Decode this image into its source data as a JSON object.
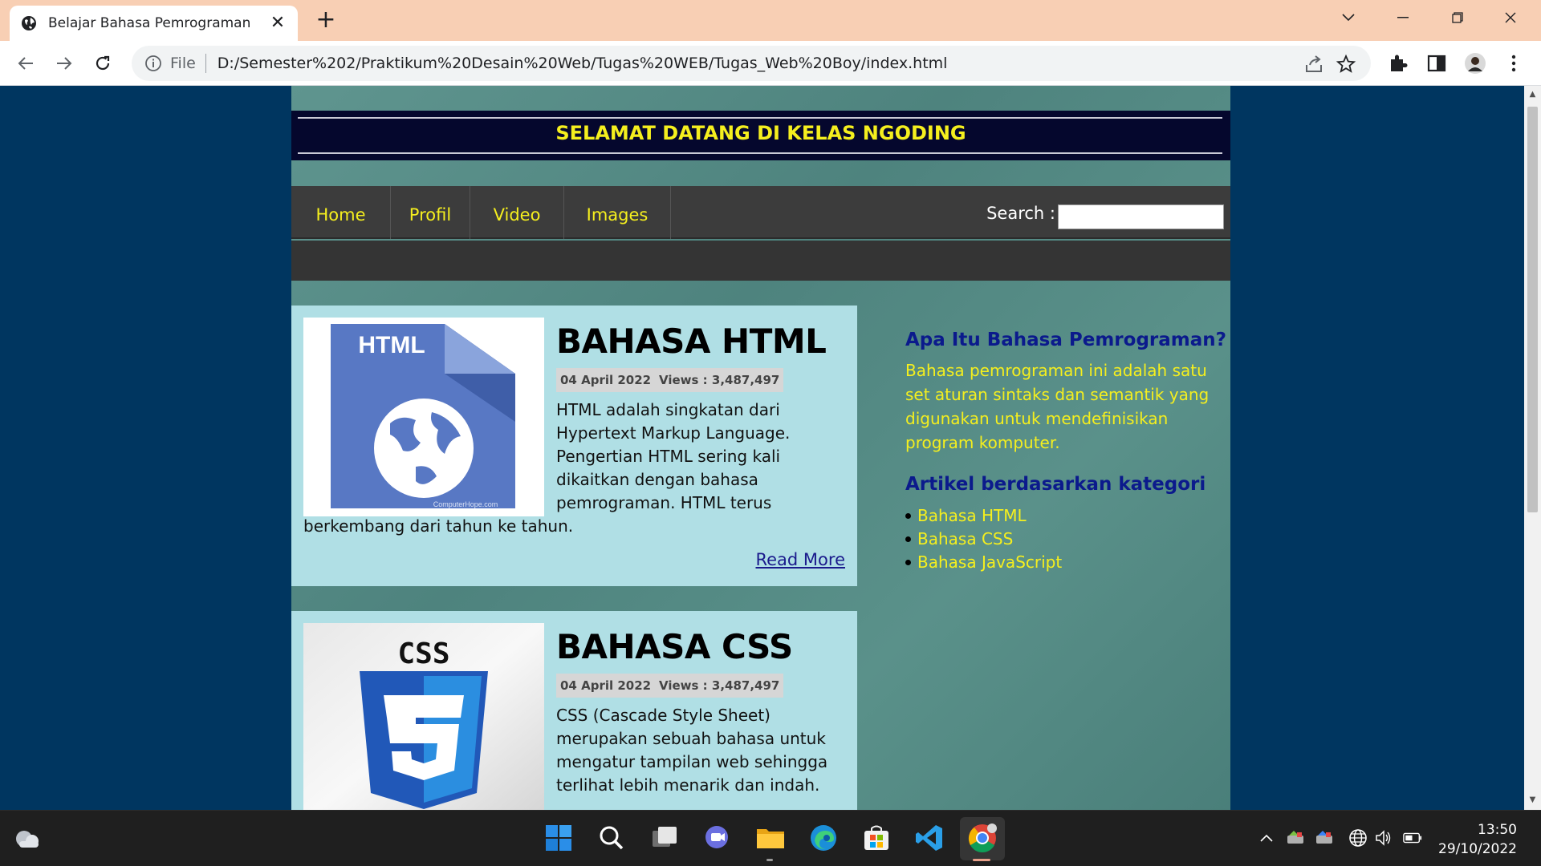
{
  "browser": {
    "tab_title": "Belajar Bahasa Pemrograman",
    "tab_close": "✕",
    "new_tab": "+",
    "scheme": "File",
    "url": "D:/Semester%202/Praktikum%20Desain%20Web/Tugas%20WEB/Tugas_Web%20Boy/index.html"
  },
  "site": {
    "banner_title": "SELAMAT DATANG DI KELAS NGODING",
    "nav": [
      "Home",
      "Profil",
      "Video",
      "Images"
    ],
    "search_label": "Search :",
    "search_value": ""
  },
  "articles": [
    {
      "title": "BAHASA HTML",
      "date": "04 April 2022",
      "views": "Views : 3,487,497",
      "body": "HTML adalah singkatan dari Hypertext Markup Language. Pengertian HTML sering kali dikaitkan dengan bahasa pemrograman. HTML terus",
      "body_tail": "berkembang dari tahun ke tahun.",
      "read_more": "Read More",
      "image_label": "HTML",
      "image_credit": "ComputerHope.com"
    },
    {
      "title": "BAHASA CSS",
      "date": "04 April 2022",
      "views": "Views : 3,487,497",
      "body": "CSS (Cascade Style Sheet) merupakan sebuah bahasa untuk mengatur tampilan web sehingga terlihat lebih menarik dan indah.",
      "image_label": "CSS"
    }
  ],
  "sidebar": {
    "heading1": "Apa Itu Bahasa Pemrograman?",
    "paragraph": "Bahasa pemrograman ini adalah satu set aturan sintaks dan semantik yang digunakan untuk mendefinisikan program komputer.",
    "heading2": "Artikel berdasarkan kategori",
    "categories": [
      "Bahasa HTML",
      "Bahasa CSS",
      "Bahasa JavaScript"
    ]
  },
  "taskbar": {
    "time": "13:50",
    "date": "29/10/2022"
  },
  "colors": {
    "page_bg": "#003660",
    "banner_bg": "#05072d",
    "accent_yellow": "#f5ef1e",
    "article_bg": "#b0dfe5",
    "sidebar_heading": "#0b1a8c",
    "tabbar_bg": "#f8cfb4"
  }
}
